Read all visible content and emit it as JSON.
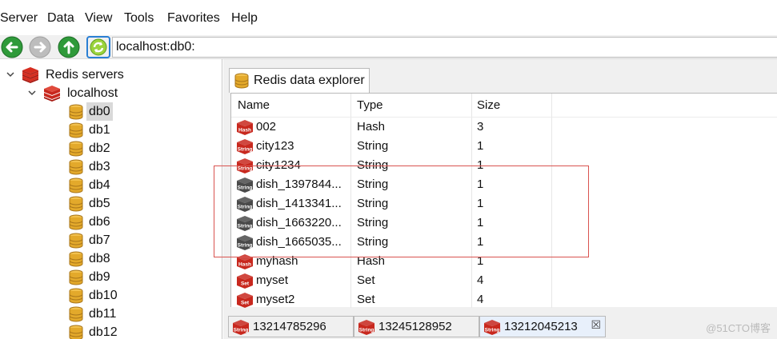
{
  "menu": {
    "items": [
      "Server",
      "Data",
      "View",
      "Tools",
      "Favorites",
      "Help"
    ]
  },
  "toolbar": {
    "back_icon": "back-arrow-icon",
    "forward_icon": "forward-arrow-icon",
    "up_icon": "up-arrow-icon",
    "refresh_icon": "refresh-icon",
    "address": "localhost:db0:"
  },
  "tree": {
    "root": "Redis servers",
    "server": "localhost",
    "databases": [
      "db0",
      "db1",
      "db2",
      "db3",
      "db4",
      "db5",
      "db6",
      "db7",
      "db8",
      "db9",
      "db10",
      "db11",
      "db12"
    ],
    "selected": "db0"
  },
  "explorer": {
    "tab_label": "Redis data explorer",
    "columns": [
      "Name",
      "Type",
      "Size"
    ],
    "rows": [
      {
        "name": "002",
        "type": "Hash",
        "size": "3",
        "icon": "Hash",
        "icon_color": "#c8281e"
      },
      {
        "name": "city123",
        "type": "String",
        "size": "1",
        "icon": "String",
        "icon_color": "#c8281e"
      },
      {
        "name": "city1234",
        "type": "String",
        "size": "1",
        "icon": "String",
        "icon_color": "#c8281e"
      },
      {
        "name": "dish_1397844...",
        "type": "String",
        "size": "1",
        "icon": "String",
        "icon_color": "#4a4a4a"
      },
      {
        "name": "dish_1413341...",
        "type": "String",
        "size": "1",
        "icon": "String",
        "icon_color": "#4a4a4a"
      },
      {
        "name": "dish_1663220...",
        "type": "String",
        "size": "1",
        "icon": "String",
        "icon_color": "#4a4a4a"
      },
      {
        "name": "dish_1665035...",
        "type": "String",
        "size": "1",
        "icon": "String",
        "icon_color": "#4a4a4a"
      },
      {
        "name": "myhash",
        "type": "Hash",
        "size": "1",
        "icon": "Hash",
        "icon_color": "#c8281e"
      },
      {
        "name": "myset",
        "type": "Set",
        "size": "4",
        "icon": "Set",
        "icon_color": "#c8281e"
      },
      {
        "name": "myset2",
        "type": "Set",
        "size": "4",
        "icon": "Set",
        "icon_color": "#c8281e"
      }
    ]
  },
  "bottom_tabs": [
    {
      "label": "13214785296",
      "icon": "String",
      "active": false
    },
    {
      "label": "13245128952",
      "icon": "String",
      "active": false
    },
    {
      "label": "13212045213",
      "icon": "String",
      "active": true,
      "close": "☒"
    }
  ],
  "watermark": "@51CTO博客",
  "colors": {
    "redis_red": "#c8281e",
    "db_gold": "#e3a92b",
    "gray_key": "#4a4a4a",
    "highlight": "#d9534f"
  }
}
